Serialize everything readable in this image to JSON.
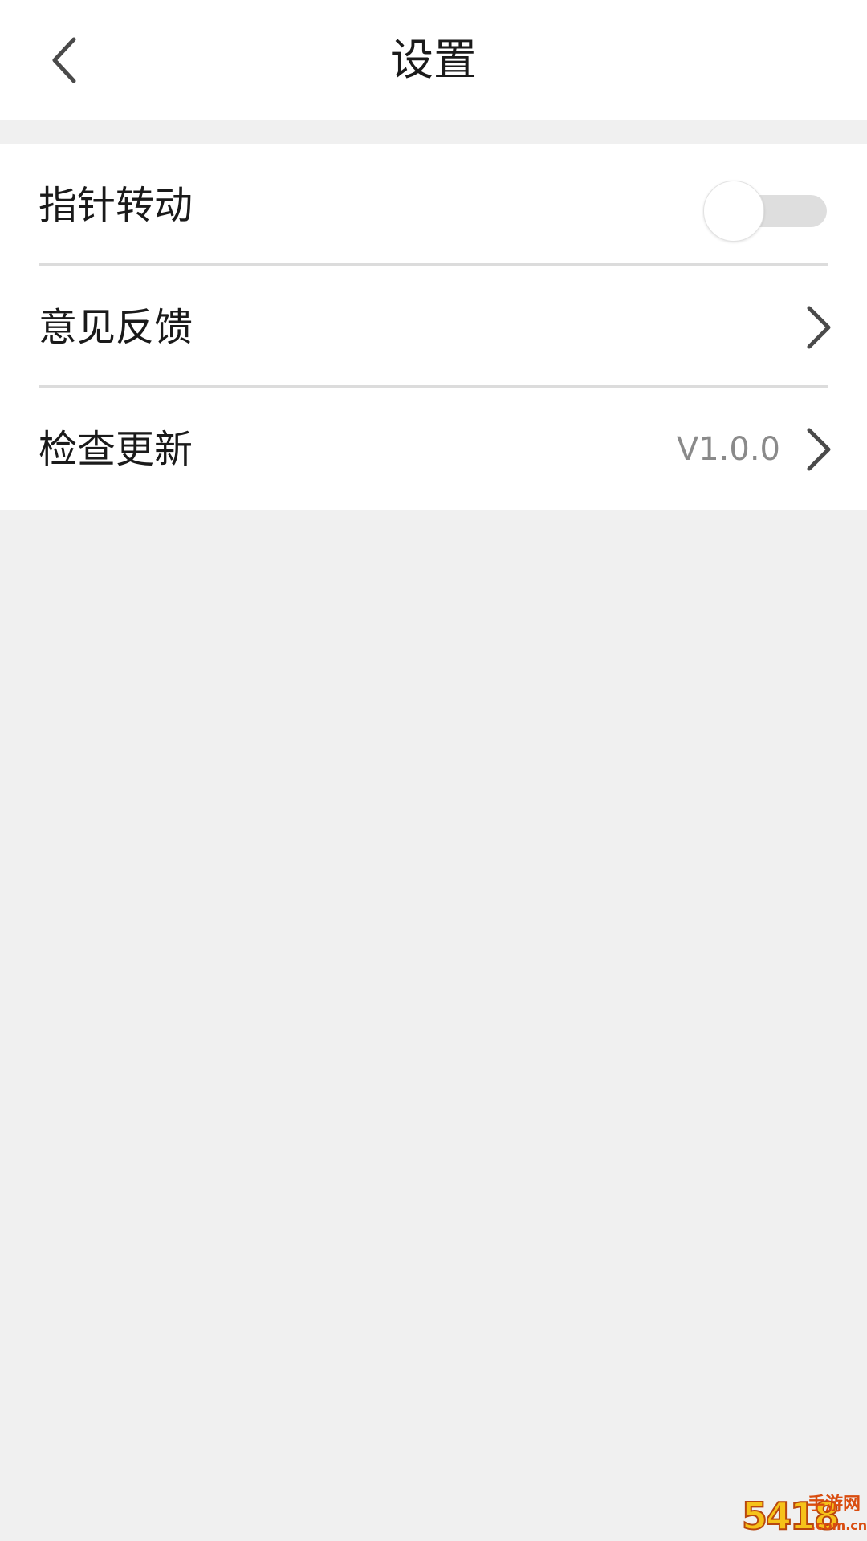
{
  "header": {
    "title": "设置",
    "back_icon": "chevron-left-icon"
  },
  "settings": {
    "pointer_rotation": {
      "label": "指针转动",
      "toggle_on": false
    },
    "feedback": {
      "label": "意见反馈",
      "icon": "chevron-right-icon"
    },
    "check_update": {
      "label": "检查更新",
      "version": "V1.0.0",
      "icon": "chevron-right-icon"
    }
  },
  "watermark": {
    "number": "5418",
    "top_text": "手游网",
    "bottom_text": ".com.cn"
  },
  "colors": {
    "background": "#f0f0f0",
    "surface": "#ffffff",
    "text_primary": "#1a1a1a",
    "text_secondary": "#8a8a8a",
    "divider": "#dcdcdc",
    "toggle_track_off": "#dedede"
  }
}
